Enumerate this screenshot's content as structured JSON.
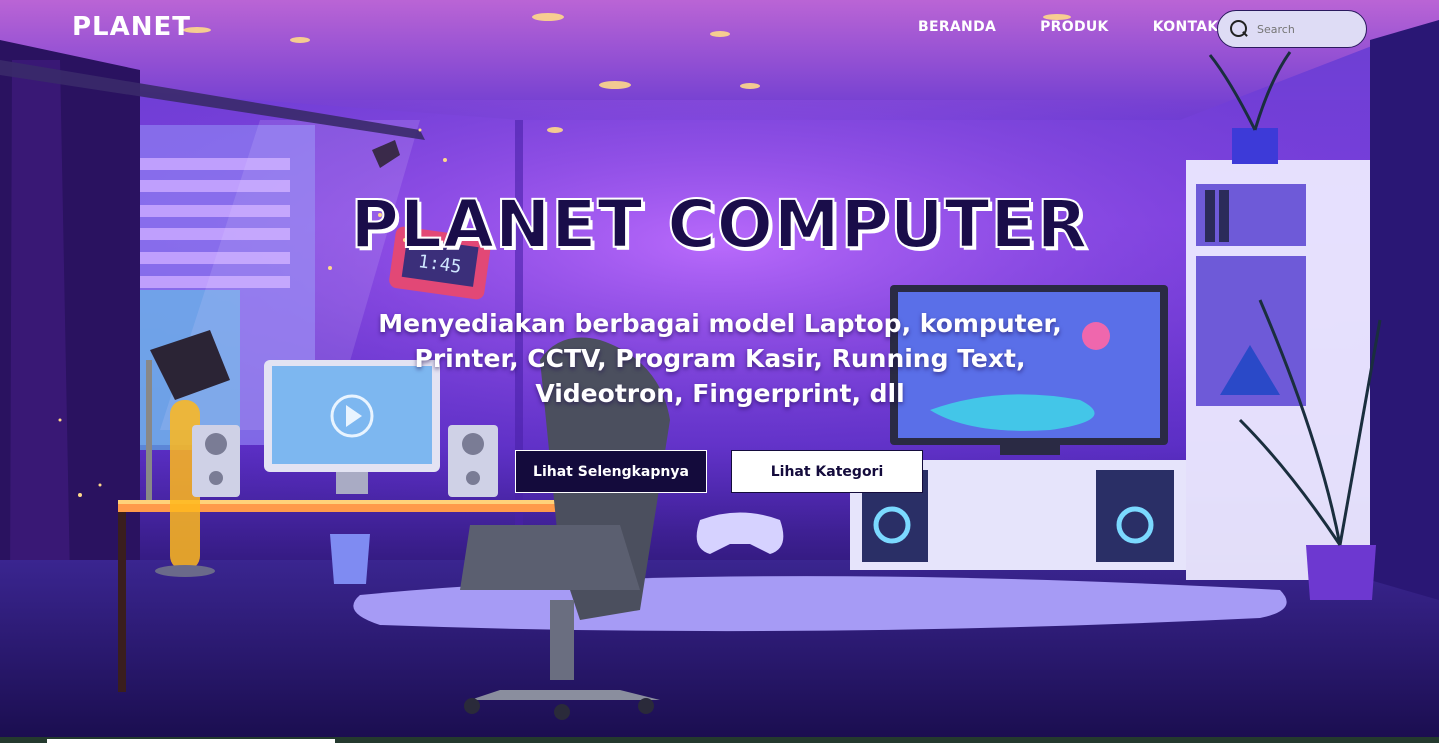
{
  "navbar": {
    "logo": "PLANET",
    "links": [
      "BERANDA",
      "PRODUK",
      "KONTAK"
    ],
    "search_placeholder": "Search"
  },
  "hero": {
    "title": "PLANET COMPUTER",
    "subtitle": "Menyediakan berbagai model Laptop, komputer, Printer, CCTV, Program Kasir, Running Text, Videotron, Fingerprint, dll",
    "primary_button": "Lihat Selengkapnya",
    "secondary_button": "Lihat Kategori",
    "clock_display": "1:45"
  }
}
